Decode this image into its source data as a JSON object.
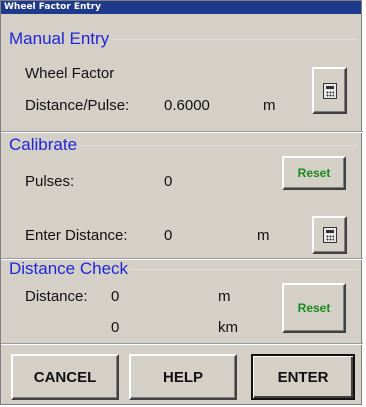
{
  "window": {
    "title": "Wheel Factor Entry"
  },
  "manual_entry": {
    "legend": "Manual Entry",
    "heading": "Wheel Factor",
    "distance_pulse_label": "Distance/Pulse:",
    "distance_pulse_value": "0.6000",
    "distance_pulse_unit": "m",
    "calc_icon": "calculator-icon"
  },
  "calibrate": {
    "legend": "Calibrate",
    "pulses_label": "Pulses:",
    "pulses_value": "0",
    "reset_label": "Reset",
    "enter_distance_label": "Enter Distance:",
    "enter_distance_value": "0",
    "enter_distance_unit": "m",
    "calc_icon": "calculator-icon"
  },
  "distance_check": {
    "legend": "Distance Check",
    "distance_label": "Distance:",
    "distance_m_value": "0",
    "distance_m_unit": "m",
    "distance_km_value": "0",
    "distance_km_unit": "km",
    "reset_label": "Reset"
  },
  "buttons": {
    "cancel": "CANCEL",
    "help": "HELP",
    "enter": "ENTER"
  },
  "colors": {
    "legend": "#1f26d6",
    "reset": "#1a8a1a",
    "titlebar": "#1e3a8a"
  }
}
